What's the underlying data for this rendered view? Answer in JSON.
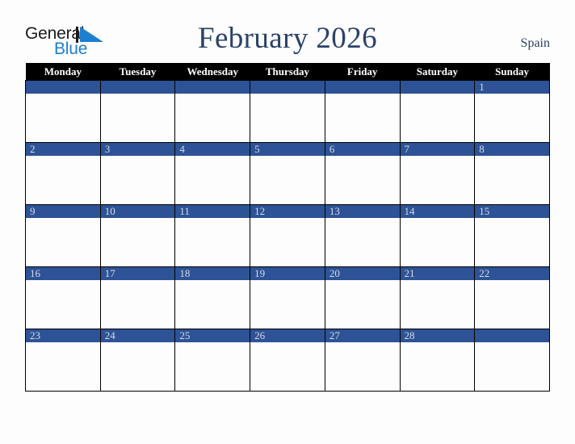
{
  "brand": {
    "name_part1": "General",
    "name_part2": "Blue",
    "mark_icon": "triangle-logo-icon",
    "colors": {
      "text_dark": "#1b1b1b",
      "blue": "#1d7fd0"
    }
  },
  "header": {
    "title": "February 2026",
    "month": "February",
    "year": "2026",
    "country": "Spain",
    "title_color": "#2b4268"
  },
  "calendar": {
    "weekday_headers": [
      "Monday",
      "Tuesday",
      "Wednesday",
      "Thursday",
      "Friday",
      "Saturday",
      "Sunday"
    ],
    "header_bg": "#000000",
    "header_text": "#ffffff",
    "day_bar_bg": "#2d5396",
    "day_number_color": "#d7dce6",
    "cell_bg": "#fdfdfd",
    "grid_line": "#000000",
    "weeks": [
      [
        {
          "num": ""
        },
        {
          "num": ""
        },
        {
          "num": ""
        },
        {
          "num": ""
        },
        {
          "num": ""
        },
        {
          "num": ""
        },
        {
          "num": "1"
        }
      ],
      [
        {
          "num": "2"
        },
        {
          "num": "3"
        },
        {
          "num": "4"
        },
        {
          "num": "5"
        },
        {
          "num": "6"
        },
        {
          "num": "7"
        },
        {
          "num": "8"
        }
      ],
      [
        {
          "num": "9"
        },
        {
          "num": "10"
        },
        {
          "num": "11"
        },
        {
          "num": "12"
        },
        {
          "num": "13"
        },
        {
          "num": "14"
        },
        {
          "num": "15"
        }
      ],
      [
        {
          "num": "16"
        },
        {
          "num": "17"
        },
        {
          "num": "18"
        },
        {
          "num": "19"
        },
        {
          "num": "20"
        },
        {
          "num": "21"
        },
        {
          "num": "22"
        }
      ],
      [
        {
          "num": "23"
        },
        {
          "num": "24"
        },
        {
          "num": "25"
        },
        {
          "num": "26"
        },
        {
          "num": "27"
        },
        {
          "num": "28"
        },
        {
          "num": ""
        }
      ]
    ]
  },
  "page": {
    "background": "#fdfdfd"
  }
}
